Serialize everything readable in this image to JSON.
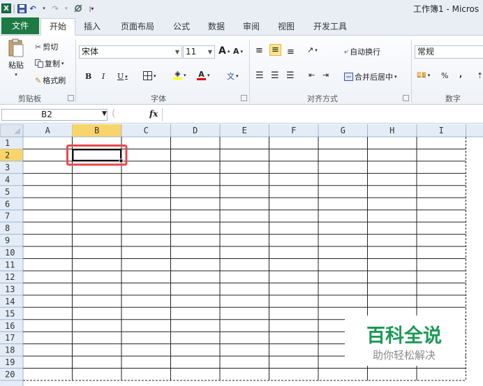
{
  "window": {
    "title": "工作簿1 - Micros"
  },
  "tabs": [
    "文件",
    "开始",
    "插入",
    "页面布局",
    "公式",
    "数据",
    "审阅",
    "视图",
    "开发工具"
  ],
  "clipboard": {
    "paste": "粘贴",
    "cut": "剪切",
    "copy": "复制",
    "format_painter": "格式刷",
    "group": "剪贴板"
  },
  "font": {
    "name": "宋体",
    "size": "11",
    "bold": "B",
    "italic": "I",
    "underline": "U",
    "group": "字体",
    "grow": "A",
    "shrink": "A",
    "phonetic": "文"
  },
  "alignment": {
    "wrap_text": "自动换行",
    "merge_center": "合并后居中",
    "group": "对齐方式"
  },
  "number": {
    "format": "常规",
    "percent": "%",
    "comma": ",",
    "group": "数字"
  },
  "formula_bar": {
    "name_box": "B2",
    "fx": "fx",
    "content": ""
  },
  "sheet": {
    "columns": [
      "A",
      "B",
      "C",
      "D",
      "E",
      "F",
      "G",
      "H",
      "I"
    ],
    "rows": [
      "1",
      "2",
      "3",
      "4",
      "5",
      "6",
      "7",
      "8",
      "9",
      "10",
      "11",
      "12",
      "13",
      "14",
      "15",
      "16",
      "17",
      "18",
      "19",
      "20"
    ],
    "selected_cell": "B2",
    "highlight_color": "#e8494d"
  },
  "watermark": {
    "title": "百科全说",
    "subtitle": "助你轻松解决",
    "color": "#1c9a55"
  }
}
